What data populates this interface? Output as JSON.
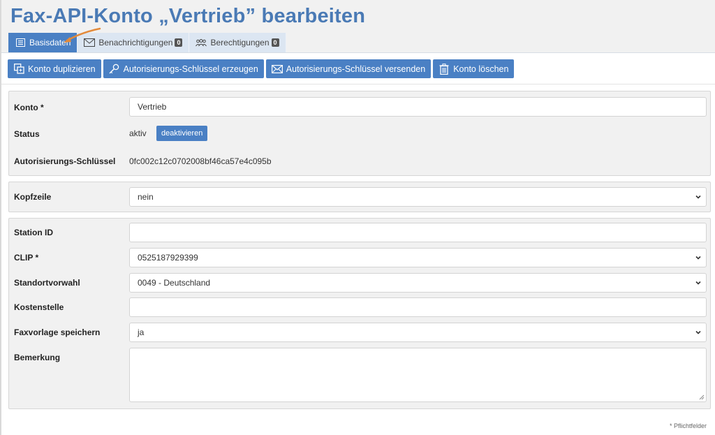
{
  "page": {
    "title": "Fax-API-Konto „Vertrieb” bearbeiten"
  },
  "tabs": [
    {
      "label": "Basisdaten",
      "icon": "list-icon",
      "active": true
    },
    {
      "label": "Benachrichtigungen",
      "icon": "envelope-icon",
      "badge": "0"
    },
    {
      "label": "Berechtigungen",
      "icon": "users-icon",
      "badge": "0"
    }
  ],
  "toolbar": {
    "duplicate": "Konto duplizieren",
    "generate_key": "Autorisierungs-Schlüssel erzeugen",
    "send_key": "Autorisierungs-Schlüssel versenden",
    "delete": "Konto löschen"
  },
  "account": {
    "konto_label": "Konto *",
    "konto_value": "Vertrieb",
    "status_label": "Status",
    "status_value": "aktiv",
    "deactivate_label": "deaktivieren",
    "key_label": "Autorisierungs-Schlüssel",
    "key_value": "0fc002c12c0702008bf46ca57e4c095b"
  },
  "header_section": {
    "kopfzeile_label": "Kopfzeile",
    "kopfzeile_value": "nein"
  },
  "details": {
    "station_id_label": "Station ID",
    "station_id_value": "",
    "clip_label": "CLIP *",
    "clip_value": "0525187929399",
    "standort_label": "Standortvorwahl",
    "standort_value": "0049 - Deutschland",
    "kostenstelle_label": "Kostenstelle",
    "kostenstelle_value": "",
    "faxvorlage_label": "Faxvorlage speichern",
    "faxvorlage_value": "ja",
    "bemerkung_label": "Bemerkung",
    "bemerkung_value": ""
  },
  "footer": {
    "required_note": "* Pflichtfelder"
  },
  "colors": {
    "accent": "#4a80c4",
    "title": "#4a7ab5",
    "panel_bg": "#f1f1f1",
    "tab_bg": "#dce6f2"
  }
}
